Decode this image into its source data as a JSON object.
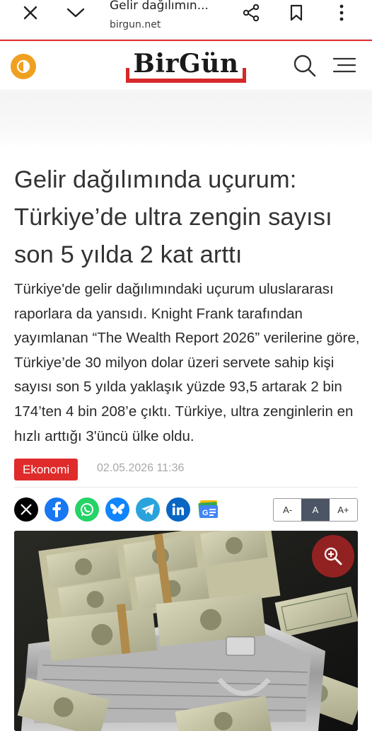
{
  "browser": {
    "tab_title": "Gelir dağılımın...",
    "domain": "birgun.net"
  },
  "site": {
    "logo_text": "BirGün"
  },
  "article": {
    "headline": "Gelir dağılımında uçurum: Türkiye’de ultra zengin sayısı son 5 yılda 2 kat arttı",
    "lead": "Türkiye'de gelir dağılımındaki uçurum uluslararası raporlara da yansıdı. Knight Frank tarafından yayımlanan “The Wealth Report 2026” verilerine göre, Türkiye’de 30 milyon dolar üzeri servete sahip kişi sayısı son 5 yılda yaklaşık yüzde 93,5 artarak 2 bin 174’ten 4 bin 208’e çıktı. Türkiye, ultra zenginlerin en hızlı arttığı 3'üncü ülke oldu.",
    "category": "Ekonomi",
    "date": "02.05.2026 11:36"
  },
  "share": [
    {
      "name": "x",
      "color": "#000000"
    },
    {
      "name": "facebook",
      "color": "#1877f2"
    },
    {
      "name": "whatsapp",
      "color": "#25d366"
    },
    {
      "name": "bluesky",
      "color": "#1185fe"
    },
    {
      "name": "telegram",
      "color": "#2aa3dc"
    },
    {
      "name": "linkedin",
      "color": "#0a66c2"
    },
    {
      "name": "google-news",
      "color": "#4285f4"
    }
  ],
  "font_controls": {
    "decrease": "A-",
    "normal": "A",
    "increase": "A+"
  },
  "colors": {
    "brand_red": "#d62828",
    "category_red": "#e02b2b",
    "theme_toggle": "#f0a020"
  }
}
